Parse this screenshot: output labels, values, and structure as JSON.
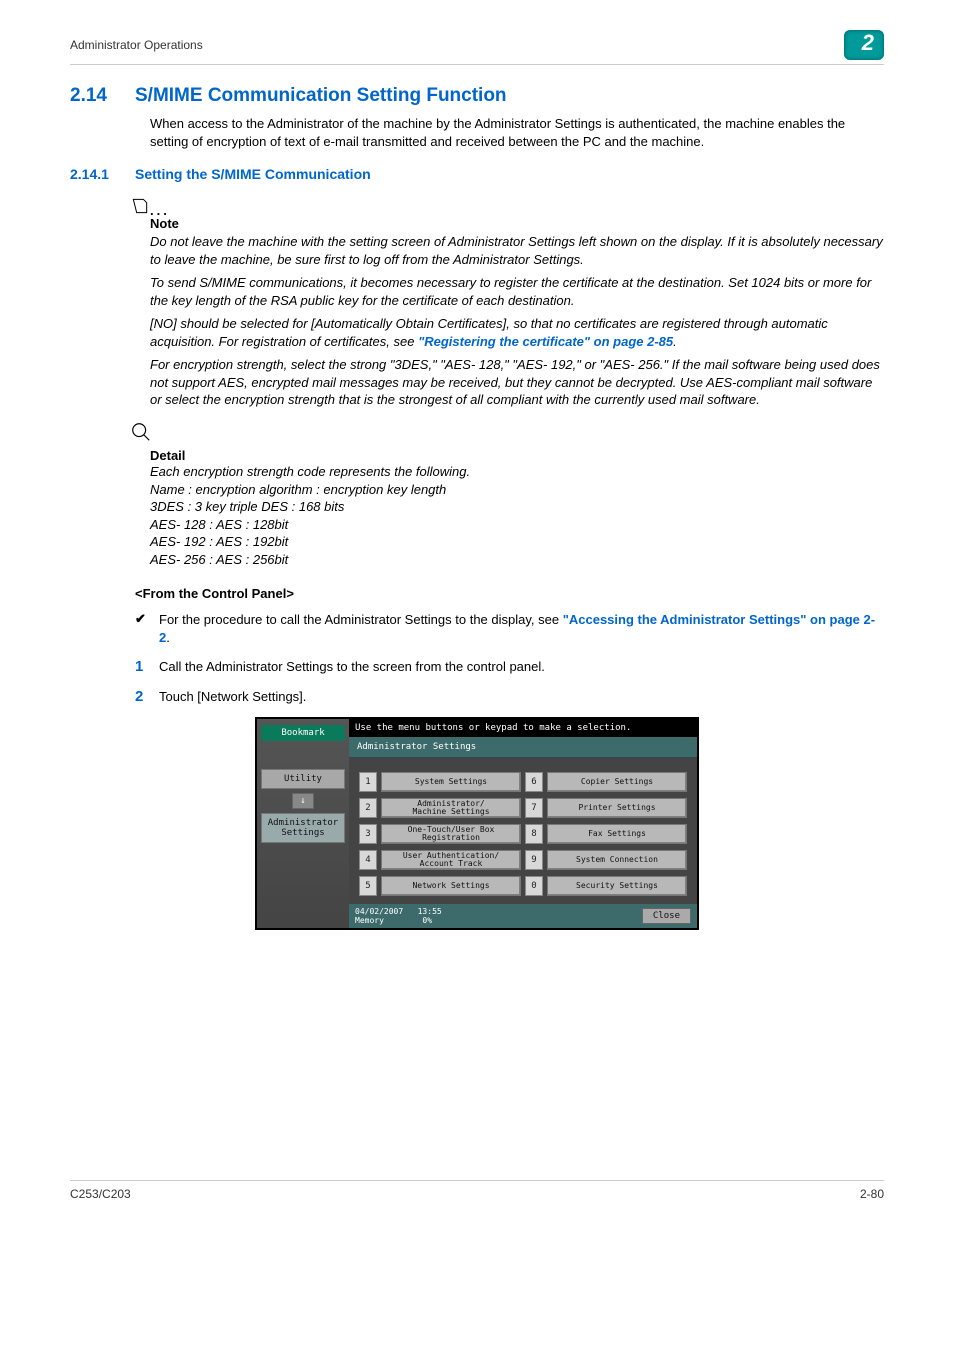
{
  "header": {
    "left": "Administrator Operations",
    "chapter_badge": "2"
  },
  "section_h2": {
    "num": "2.14",
    "title": "S/MIME Communication Setting Function"
  },
  "intro_p": "When access to the Administrator of the machine by the Administrator Settings is authenticated, the machine enables the setting of encryption of text of e-mail transmitted and received between the PC and the machine.",
  "section_h3": {
    "num": "2.14.1",
    "title": "Setting the S/MIME Communication"
  },
  "note": {
    "label": "Note",
    "p1": "Do not leave the machine with the setting screen of Administrator Settings left shown on the display. If it is absolutely necessary to leave the machine, be sure first to log off from the Administrator Settings.",
    "p2": "To send S/MIME communications, it becomes necessary to register the certificate at the destination. Set 1024 bits or more for the key length of the RSA public key for the certificate of each destination.",
    "p3_a": "[NO] should be selected for [Automatically Obtain Certificates], so that no certificates are registered through automatic acquisition. For registration of certificates, see ",
    "p3_link": "\"Registering the certificate\" on page 2-85",
    "p3_b": ".",
    "p4": "For encryption strength, select the strong \"3DES,\" \"AES- 128,\" \"AES- 192,\" or \"AES- 256.\" If the mail software being used does not support AES, encrypted mail messages may be received, but they cannot be decrypted. Use AES-compliant mail software or select the encryption strength that is the strongest of all compliant with the currently used mail software."
  },
  "detail": {
    "label": "Detail",
    "l1": "Each encryption strength code represents the following.",
    "l2": "Name : encryption algorithm : encryption key length",
    "l3": "3DES : 3 key triple DES : 168 bits",
    "l4": "AES- 128 : AES : 128bit",
    "l5": "AES- 192 : AES : 192bit",
    "l6": "AES- 256 : AES : 256bit"
  },
  "subhead": "<From the Control Panel>",
  "check_bullet": {
    "mark": "✔",
    "text_a": "For the procedure to call the Administrator Settings to the display, see ",
    "link": "\"Accessing the Administrator Settings\" on page 2-2",
    "text_b": "."
  },
  "step1": {
    "num": "1",
    "text": "Call the Administrator Settings to the screen from the control panel."
  },
  "step2": {
    "num": "2",
    "text": "Touch [Network Settings]."
  },
  "panel": {
    "topmsg": "Use the menu buttons or keypad to make a selection.",
    "title": "Administrator Settings",
    "bookmark": "Bookmark",
    "side_utility": "Utility",
    "side_admin": "Administrator Settings",
    "arrow": "↓",
    "rows": [
      {
        "ln": "1",
        "ll": "System Settings",
        "rn": "6",
        "rl": "Copier Settings"
      },
      {
        "ln": "2",
        "ll": "Administrator/\nMachine Settings",
        "rn": "7",
        "rl": "Printer Settings"
      },
      {
        "ln": "3",
        "ll": "One-Touch/User Box\nRegistration",
        "rn": "8",
        "rl": "Fax Settings"
      },
      {
        "ln": "4",
        "ll": "User Authentication/\nAccount Track",
        "rn": "9",
        "rl": "System Connection"
      },
      {
        "ln": "5",
        "ll": "Network Settings",
        "rn": "0",
        "rl": "Security Settings"
      }
    ],
    "status_left": "04/02/2007   13:55\nMemory        0%",
    "close": "Close"
  },
  "footer": {
    "left": "C253/C203",
    "right": "2-80"
  }
}
